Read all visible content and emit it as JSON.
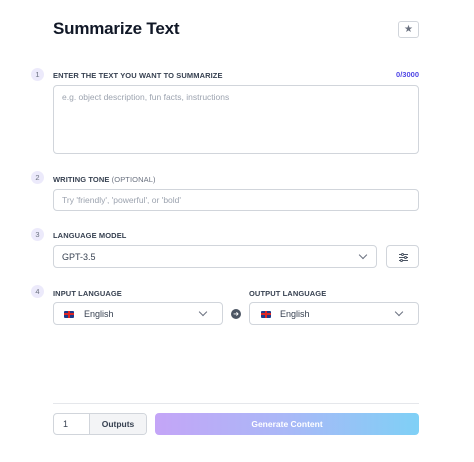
{
  "page": {
    "title": "Summarize Text"
  },
  "header": {
    "favorite_icon": "star-icon",
    "favorite_glyph": "★"
  },
  "steps": [
    "1",
    "2",
    "3",
    "4"
  ],
  "text_input": {
    "label": "ENTER THE TEXT YOU WANT TO SUMMARIZE",
    "counter": "0/3000",
    "placeholder": "e.g. object description, fun facts, instructions",
    "value": ""
  },
  "tone": {
    "label": "WRITING TONE",
    "optional": "(OPTIONAL)",
    "placeholder": "Try 'friendly', 'powerful', or 'bold'",
    "value": ""
  },
  "model": {
    "label": "LANGUAGE MODEL",
    "selected": "GPT-3.5",
    "settings_icon": "sliders-icon"
  },
  "languages": {
    "input_label": "INPUT LANGUAGE",
    "input_value": "English",
    "output_label": "OUTPUT LANGUAGE",
    "output_value": "English",
    "flag_icon": "uk-flag-icon",
    "swap_icon": "arrow-right-circle-icon",
    "swap_glyph": "➜"
  },
  "footer": {
    "outputs_count": "1",
    "outputs_label": "Outputs",
    "generate_label": "Generate Content"
  },
  "colors": {
    "accent": "#4f46e5",
    "gradient_start": "#c4a5f7",
    "gradient_end": "#7fd0f6"
  }
}
